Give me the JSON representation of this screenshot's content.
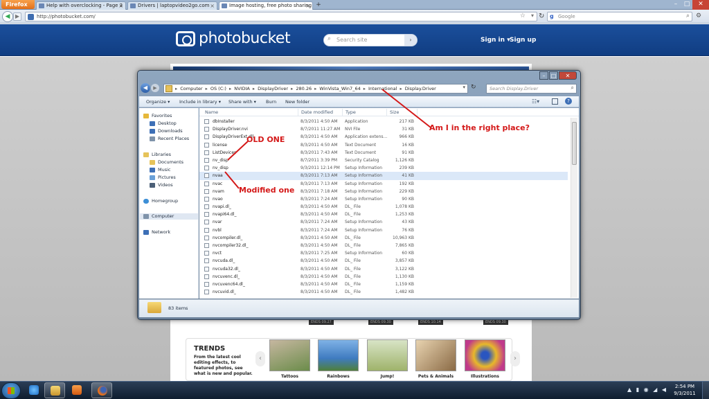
{
  "browser": {
    "firefox_label": "Firefox",
    "tabs": [
      {
        "title": "Help with overclocking - Page 3"
      },
      {
        "title": "Drivers | laptopvideo2go.com"
      },
      {
        "title": "Image hosting, free photo sharing & ..."
      }
    ],
    "new_tab_symbol": "+",
    "url": "http://photobucket.com/",
    "search_engine": "Google",
    "controls": {
      "minimize": "–",
      "maximize": "□",
      "close": "✕"
    }
  },
  "photobucket": {
    "logo": "photobucket",
    "search_placeholder": "Search site",
    "signin": "Sign in",
    "signin_caret": "▾",
    "signup": "Sign up",
    "ends_labels": [
      "ENDS 09.27",
      "ENDS 09.30",
      "ENDS 10.14",
      "ENDS 09.30"
    ],
    "trends": {
      "title": "TRENDS",
      "description": "From the latest cool editing effects, to featured photos, see what is new and popular.",
      "items": [
        {
          "label": "Tattoos",
          "color": "#6b8c4a"
        },
        {
          "label": "Rainbows",
          "color": "#4f8fd0"
        },
        {
          "label": "Jump!",
          "color": "#9fb36b"
        },
        {
          "label": "Pets & Animals",
          "color": "#8a6a45"
        },
        {
          "label": "Illustrations",
          "color": "#e8b82a"
        }
      ]
    }
  },
  "explorer": {
    "breadcrumb": [
      "Computer",
      "OS (C:)",
      "NVIDIA",
      "DisplayDriver",
      "280.26",
      "WinVista_Win7_64",
      "International",
      "Display.Driver"
    ],
    "search_placeholder": "Search Display.Driver",
    "toolbar": {
      "organize": "Organize ▾",
      "include": "Include in library ▾",
      "share": "Share with ▾",
      "burn": "Burn",
      "new_folder": "New folder"
    },
    "nav": {
      "favorites": "Favorites",
      "desktop": "Desktop",
      "downloads": "Downloads",
      "recent": "Recent Places",
      "libraries": "Libraries",
      "documents": "Documents",
      "music": "Music",
      "pictures": "Pictures",
      "videos": "Videos",
      "homegroup": "Homegroup",
      "computer": "Computer",
      "network": "Network"
    },
    "columns": {
      "name": "Name",
      "date": "Date modified",
      "type": "Type",
      "size": "Size"
    },
    "files": [
      {
        "name": "dbInstaller",
        "date": "8/3/2011 4:50 AM",
        "type": "Application",
        "size": "217 KB"
      },
      {
        "name": "DisplayDriver.nvi",
        "date": "8/7/2011 11:27 AM",
        "type": "NVI File",
        "size": "31 KB"
      },
      {
        "name": "DisplayDriverExt.dll",
        "date": "8/3/2011 4:50 AM",
        "type": "Application extens...",
        "size": "966 KB"
      },
      {
        "name": "license",
        "date": "8/3/2011 4:50 AM",
        "type": "Text Document",
        "size": "16 KB"
      },
      {
        "name": "ListDevices",
        "date": "8/3/2011 7:43 AM",
        "type": "Text Document",
        "size": "91 KB"
      },
      {
        "name": "nv_disp",
        "date": "8/7/2011 3:39 PM",
        "type": "Security Catalog",
        "size": "1,126 KB"
      },
      {
        "name": "nv_disp",
        "date": "9/3/2011 12:14 PM",
        "type": "Setup Information",
        "size": "239 KB"
      },
      {
        "name": "nvaa",
        "date": "8/3/2011 7:13 AM",
        "type": "Setup Information",
        "size": "41 KB"
      },
      {
        "name": "nvac",
        "date": "8/3/2011 7:13 AM",
        "type": "Setup Information",
        "size": "192 KB"
      },
      {
        "name": "nvam",
        "date": "8/3/2011 7:18 AM",
        "type": "Setup Information",
        "size": "229 KB"
      },
      {
        "name": "nvao",
        "date": "8/3/2011 7:24 AM",
        "type": "Setup Information",
        "size": "90 KB"
      },
      {
        "name": "nvapi.dl_",
        "date": "8/3/2011 4:50 AM",
        "type": "DL_ File",
        "size": "1,078 KB"
      },
      {
        "name": "nvapi64.dl_",
        "date": "8/3/2011 4:50 AM",
        "type": "DL_ File",
        "size": "1,253 KB"
      },
      {
        "name": "nvar",
        "date": "8/3/2011 7:24 AM",
        "type": "Setup Information",
        "size": "43 KB"
      },
      {
        "name": "nvbl",
        "date": "8/3/2011 7:24 AM",
        "type": "Setup Information",
        "size": "76 KB"
      },
      {
        "name": "nvcompiler.dl_",
        "date": "8/3/2011 4:50 AM",
        "type": "DL_ File",
        "size": "10,963 KB"
      },
      {
        "name": "nvcompiler32.dl_",
        "date": "8/3/2011 4:50 AM",
        "type": "DL_ File",
        "size": "7,865 KB"
      },
      {
        "name": "nvct",
        "date": "8/3/2011 7:25 AM",
        "type": "Setup Information",
        "size": "60 KB"
      },
      {
        "name": "nvcuda.dl_",
        "date": "8/3/2011 4:50 AM",
        "type": "DL_ File",
        "size": "3,857 KB"
      },
      {
        "name": "nvcuda32.dl_",
        "date": "8/3/2011 4:50 AM",
        "type": "DL_ File",
        "size": "3,122 KB"
      },
      {
        "name": "nvcuvenc.dl_",
        "date": "8/3/2011 4:50 AM",
        "type": "DL_ File",
        "size": "1,130 KB"
      },
      {
        "name": "nvcuvenc64.dl_",
        "date": "8/3/2011 4:50 AM",
        "type": "DL_ File",
        "size": "1,159 KB"
      },
      {
        "name": "nvcuvid.dl_",
        "date": "8/3/2011 4:50 AM",
        "type": "DL_ File",
        "size": "1,482 KB"
      }
    ],
    "status": "83 items"
  },
  "annotations": {
    "right_place": "Am I in the right place?",
    "old_one": "OLD ONE",
    "modified_one": "Modified one",
    "color": "#d41818"
  },
  "taskbar": {
    "apps": [
      "ie-icon",
      "explorer-icon",
      "media-player-icon",
      "firefox-icon"
    ],
    "time": "2:54 PM",
    "date": "9/3/2011"
  }
}
